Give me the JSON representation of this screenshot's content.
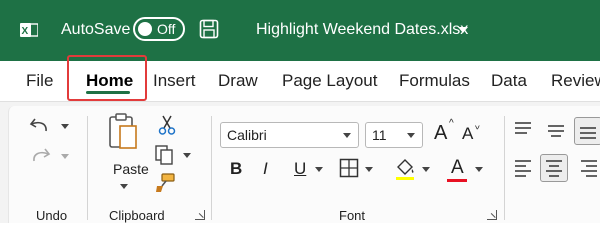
{
  "titlebar": {
    "app_icon": "excel-icon",
    "autosave_label": "AutoSave",
    "autosave_state": "Off",
    "save_icon": "save-icon",
    "filename": "Highlight Weekend Dates.xlsx"
  },
  "tabs": [
    {
      "label": "File",
      "active": false
    },
    {
      "label": "Home",
      "active": true
    },
    {
      "label": "Insert",
      "active": false
    },
    {
      "label": "Draw",
      "active": false
    },
    {
      "label": "Page Layout",
      "active": false
    },
    {
      "label": "Formulas",
      "active": false
    },
    {
      "label": "Data",
      "active": false
    },
    {
      "label": "Review",
      "active": false
    }
  ],
  "ribbon": {
    "undo_group": {
      "label": "Undo",
      "icons": [
        "undo-icon",
        "redo-icon"
      ]
    },
    "clipboard_group": {
      "label": "Clipboard",
      "paste_label": "Paste",
      "icons": [
        "paste-icon",
        "cut-icon",
        "copy-icon",
        "format-painter-icon"
      ]
    },
    "font_group": {
      "label": "Font",
      "font_name": "Calibri",
      "font_size": "11",
      "increase_font": "A",
      "decrease_font": "A",
      "bold": "B",
      "italic": "I",
      "underline": "U",
      "font_color_letter": "A",
      "font_color": "#e81123"
    },
    "alignment_group": {
      "icons": [
        "align-top-icon",
        "align-middle-icon",
        "align-bottom-icon",
        "align-left-icon",
        "align-center-icon",
        "align-right-icon"
      ]
    }
  },
  "colors": {
    "titlebar": "#1e7145",
    "highlight_box": "#e23b3b",
    "active_tab_underline": "#1e7145"
  }
}
